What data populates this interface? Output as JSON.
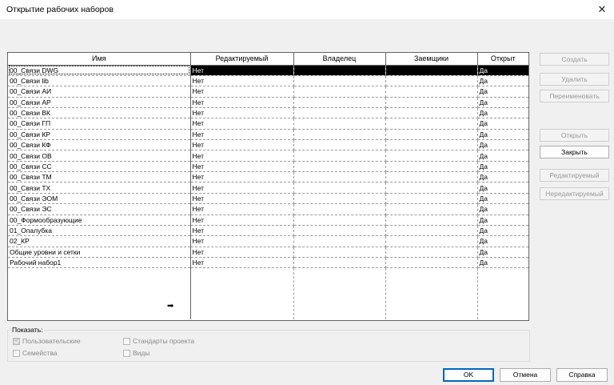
{
  "window": {
    "title": "Открытие рабочих наборов"
  },
  "table": {
    "columns": [
      "Имя",
      "Редактируемый",
      "Владелец",
      "Заемщики",
      "Открыт"
    ],
    "rows": [
      {
        "name": "00_Связи DWG",
        "editable": "Нет",
        "owner": "",
        "borrowers": "",
        "open": "Да"
      },
      {
        "name": "00_Связи lib",
        "editable": "Нет",
        "owner": "",
        "borrowers": "",
        "open": "Да"
      },
      {
        "name": "00_Связи АИ",
        "editable": "Нет",
        "owner": "",
        "borrowers": "",
        "open": "Да"
      },
      {
        "name": "00_Связи АР",
        "editable": "Нет",
        "owner": "",
        "borrowers": "",
        "open": "Да"
      },
      {
        "name": "00_Связи ВК",
        "editable": "Нет",
        "owner": "",
        "borrowers": "",
        "open": "Да"
      },
      {
        "name": "00_Связи ГП",
        "editable": "Нет",
        "owner": "",
        "borrowers": "",
        "open": "Да"
      },
      {
        "name": "00_Связи КР",
        "editable": "Нет",
        "owner": "",
        "borrowers": "",
        "open": "Да"
      },
      {
        "name": "00_Связи КФ",
        "editable": "Нет",
        "owner": "",
        "borrowers": "",
        "open": "Да"
      },
      {
        "name": "00_Связи ОВ",
        "editable": "Нет",
        "owner": "",
        "borrowers": "",
        "open": "Да"
      },
      {
        "name": "00_Связи СС",
        "editable": "Нет",
        "owner": "",
        "borrowers": "",
        "open": "Да"
      },
      {
        "name": "00_Связи ТМ",
        "editable": "Нет",
        "owner": "",
        "borrowers": "",
        "open": "Да"
      },
      {
        "name": "00_Связи ТХ",
        "editable": "Нет",
        "owner": "",
        "borrowers": "",
        "open": "Да"
      },
      {
        "name": "00_Связи ЭОМ",
        "editable": "Нет",
        "owner": "",
        "borrowers": "",
        "open": "Да"
      },
      {
        "name": "00_Связи ЭС",
        "editable": "Нет",
        "owner": "",
        "borrowers": "",
        "open": "Да"
      },
      {
        "name": "00_Формообразующие",
        "editable": "Нет",
        "owner": "",
        "borrowers": "",
        "open": "Да"
      },
      {
        "name": "01_Опалубка",
        "editable": "Нет",
        "owner": "",
        "borrowers": "",
        "open": "Да"
      },
      {
        "name": "02_КР",
        "editable": "Нет",
        "owner": "",
        "borrowers": "",
        "open": "Да"
      },
      {
        "name": "Общие уровни и сетки",
        "editable": "Нет",
        "owner": "",
        "borrowers": "",
        "open": "Да"
      },
      {
        "name": "Рабочий набор1",
        "editable": "Нет",
        "owner": "",
        "borrowers": "",
        "open": "Да"
      }
    ],
    "selected_index": 0
  },
  "side_buttons": {
    "create": "Создать",
    "delete": "Удалить",
    "rename": "Переименовать",
    "open": "Открыть",
    "close": "Закрыть",
    "editable": "Редактируемый",
    "non_editable": "Нередактируемый"
  },
  "show": {
    "label": "Показать:",
    "user": "Пользовательские",
    "families": "Семейства",
    "standards": "Стандарты проекта",
    "views": "Виды"
  },
  "footer": {
    "ok": "OK",
    "cancel": "Отмена",
    "help": "Справка"
  }
}
